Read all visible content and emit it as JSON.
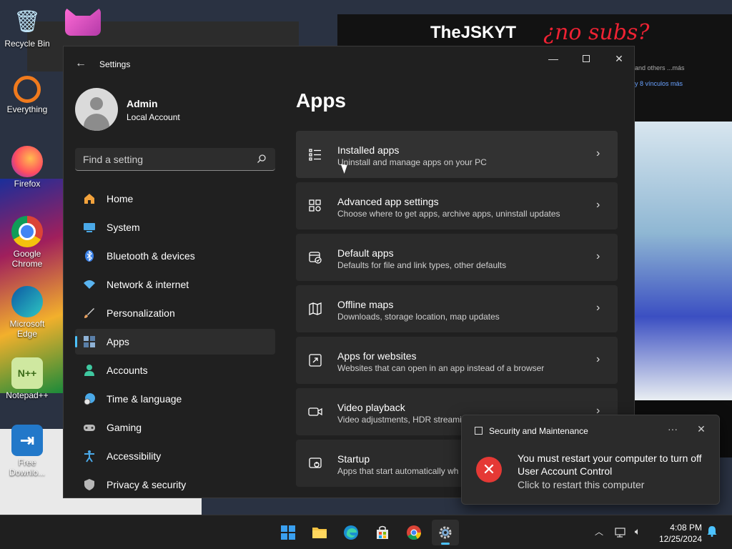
{
  "desktop": {
    "icons": [
      {
        "label": "Recycle Bin",
        "glyph": "🗑"
      },
      {
        "label": "Everything",
        "glyph": ""
      },
      {
        "label": "Firefox",
        "glyph": ""
      },
      {
        "label": "Google Chrome",
        "glyph": ""
      },
      {
        "label": "Microsoft Edge",
        "glyph": ""
      },
      {
        "label": "Notepad++",
        "glyph": "N++"
      },
      {
        "label": "Free Downlo...",
        "glyph": "⇥"
      }
    ],
    "background": {
      "channel_name": "TheJSKYT",
      "handwriting": "¿no subs?",
      "line1": "and others ...más",
      "line2": "y 8 vínculos más"
    }
  },
  "settings": {
    "window_title": "Settings",
    "profile": {
      "name": "Admin",
      "account_type": "Local Account"
    },
    "search": {
      "placeholder": "Find a setting"
    },
    "nav": [
      {
        "label": "Home",
        "icon": "home-icon",
        "color": "#f2a23c"
      },
      {
        "label": "System",
        "icon": "system-icon",
        "color": "#4aa9e8"
      },
      {
        "label": "Bluetooth & devices",
        "icon": "bluetooth-icon",
        "color": "#3b82e8"
      },
      {
        "label": "Network & internet",
        "icon": "network-icon",
        "color": "#5ab4f0"
      },
      {
        "label": "Personalization",
        "icon": "brush-icon",
        "color": "#e8a060"
      },
      {
        "label": "Apps",
        "icon": "apps-icon",
        "color": "#8fb2d6"
      },
      {
        "label": "Accounts",
        "icon": "accounts-icon",
        "color": "#3fc8a0"
      },
      {
        "label": "Time & language",
        "icon": "globe-icon",
        "color": "#4aa9e8"
      },
      {
        "label": "Gaming",
        "icon": "gaming-icon",
        "color": "#b8b8b8"
      },
      {
        "label": "Accessibility",
        "icon": "accessibility-icon",
        "color": "#4aa9e8"
      },
      {
        "label": "Privacy & security",
        "icon": "shield-icon",
        "color": "#b8b8b8"
      }
    ],
    "active_nav": "Apps",
    "page_title": "Apps",
    "cards": [
      {
        "title": "Installed apps",
        "desc": "Uninstall and manage apps on your PC",
        "icon": "installed-apps-icon"
      },
      {
        "title": "Advanced app settings",
        "desc": "Choose where to get apps, archive apps, uninstall updates",
        "icon": "advanced-settings-icon"
      },
      {
        "title": "Default apps",
        "desc": "Defaults for file and link types, other defaults",
        "icon": "default-apps-icon"
      },
      {
        "title": "Offline maps",
        "desc": "Downloads, storage location, map updates",
        "icon": "map-icon"
      },
      {
        "title": "Apps for websites",
        "desc": "Websites that can open in an app instead of a browser",
        "icon": "external-link-icon"
      },
      {
        "title": "Video playback",
        "desc": "Video adjustments, HDR streami",
        "icon": "video-icon"
      },
      {
        "title": "Startup",
        "desc": "Apps that start automatically wh",
        "icon": "startup-icon"
      }
    ]
  },
  "toast": {
    "app_name": "Security and Maintenance",
    "line1": "You must restart your computer to turn off",
    "line2": "User Account Control",
    "line3": "Click to restart this computer"
  },
  "taskbar": {
    "time": "4:08 PM",
    "date": "12/25/2024"
  },
  "colors": {
    "accent": "#4cc2ff",
    "error": "#e53935",
    "window_bg": "#202020",
    "card_bg": "#2b2b2b"
  }
}
